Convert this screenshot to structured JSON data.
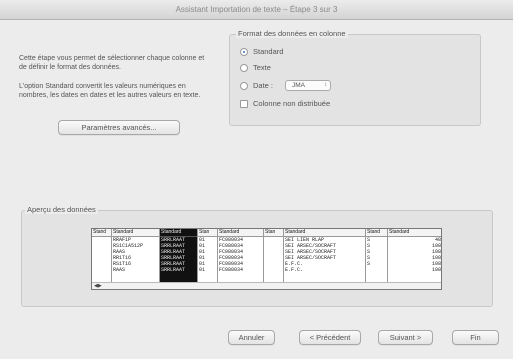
{
  "window": {
    "title": "Assistant Importation de texte – Étape 3 sur 3"
  },
  "instructions": {
    "para1": "Cette étape vous permet de sélectionner chaque colonne et de définir le format des données.",
    "para2": "L'option Standard convertit les valeurs numériques en nombres, les dates en dates et les autres valeurs en texte."
  },
  "buttons": {
    "advanced": "Paramètres avancés...",
    "cancel": "Annuler",
    "previous": "< Précédent",
    "next": "Suivant >",
    "finish": "Fin"
  },
  "column_format": {
    "group_label": "Format des données en colonne",
    "options": [
      "Standard",
      "Texte",
      "Date :",
      "Colonne non distribuée"
    ],
    "selected": "Standard",
    "date_format": "JMA"
  },
  "preview": {
    "group_label": "Aperçu des données",
    "columns": [
      {
        "header": "Stand",
        "rows": [
          "",
          "",
          "",
          "",
          "",
          "",
          ""
        ]
      },
      {
        "header": "Standard",
        "rows": [
          "RRAF1P",
          "RS1C1A512P",
          "RAAS",
          "RR1T16",
          "RS1T16",
          "RAAS",
          ""
        ]
      },
      {
        "header": "Standard",
        "rows": [
          "SRRLRAAT",
          "SRRLRAAT",
          "SRRLRAAT",
          "SRRLRAAT",
          "SRRLRAAT",
          "SRRLRAAT",
          ""
        ]
      },
      {
        "header": "Stan",
        "rows": [
          "01",
          "01",
          "01",
          "01",
          "01",
          "01",
          ""
        ]
      },
      {
        "header": "Standard",
        "rows": [
          "FC080034",
          "FC080034",
          "FC080034",
          "FC080034",
          "FC080034",
          "FC080034",
          ""
        ]
      },
      {
        "header": "Stan",
        "rows": [
          "",
          "",
          "",
          "",
          "",
          "",
          ""
        ]
      },
      {
        "header": "Standard",
        "rows": [
          "SEI LIEN RLAP",
          "SEI ARSEC/SOCRAFT",
          "SEI ARSEC/SOCRAFT",
          "SEI ARSEC/SOCRAFT",
          "E.F.C.",
          "E.F.C.",
          ""
        ]
      },
      {
        "header": "Stand",
        "rows": [
          "",
          "S",
          "S",
          "S",
          "S",
          "S",
          ""
        ]
      },
      {
        "header": "Standard",
        "rows": [
          "48",
          "108",
          "108",
          "108",
          "108",
          "108",
          ""
        ]
      }
    ]
  }
}
